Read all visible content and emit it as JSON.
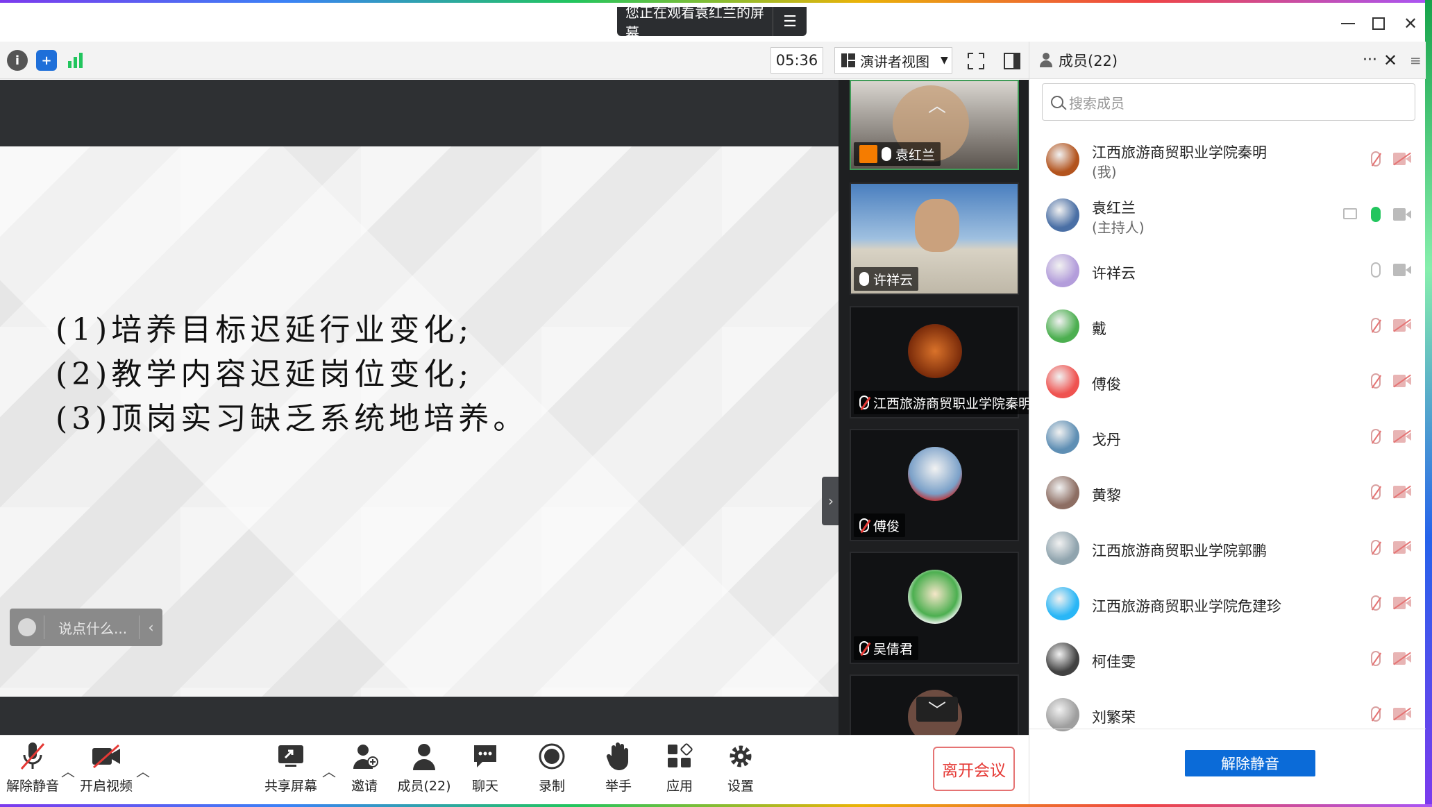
{
  "title_bar": {
    "share_banner": "您正在观看袁红兰的屏幕",
    "menu_glyph": "☰"
  },
  "toolbar": {
    "timer": "05:36",
    "view_mode": "演讲者视图"
  },
  "slide": {
    "lines": [
      "(1)培养目标迟延行业变化;",
      "(2)教学内容迟延岗位变化;",
      "(3)顶岗实习缺乏系统地培养。"
    ]
  },
  "chat_bubble": {
    "placeholder": "说点什么..."
  },
  "video_tiles": [
    {
      "name": "袁红兰",
      "mic": "on",
      "active": true,
      "avatar_color": "#c8a07a"
    },
    {
      "name": "许祥云",
      "mic": "on",
      "active": false,
      "avatar_color": "#8ab4d8"
    },
    {
      "name": "江西旅游商贸职业学院秦明",
      "mic": "off",
      "active": false,
      "avatar_color": "#b3541e"
    },
    {
      "name": "傅俊",
      "mic": "off",
      "active": false,
      "avatar_color": "#7aa0c8"
    },
    {
      "name": "吴倩君",
      "mic": "off",
      "active": false,
      "avatar_color": "#4caf50"
    }
  ],
  "members_panel": {
    "title": "成员(22)",
    "more_glyph": "···",
    "search_placeholder": "搜索成员",
    "members": [
      {
        "name": "江西旅游商贸职业学院秦明",
        "sub": "(我)",
        "mic": "off",
        "cam": "off",
        "avatar_color": "#b3541e"
      },
      {
        "name": "袁红兰",
        "sub": "(主持人)",
        "mic": "green",
        "cam": "on",
        "share": true,
        "avatar_color": "#4a6fa5"
      },
      {
        "name": "许祥云",
        "sub": "",
        "mic": "grey",
        "cam": "on",
        "avatar_color": "#b39ddb"
      },
      {
        "name": "戴",
        "sub": "",
        "mic": "off",
        "cam": "off",
        "avatar_color": "#4caf50"
      },
      {
        "name": "傅俊",
        "sub": "",
        "mic": "off",
        "cam": "off",
        "avatar_color": "#ef5350"
      },
      {
        "name": "戈丹",
        "sub": "",
        "mic": "off",
        "cam": "off",
        "avatar_color": "#5f8fb4"
      },
      {
        "name": "黄黎",
        "sub": "",
        "mic": "off",
        "cam": "off",
        "avatar_color": "#8d6e63"
      },
      {
        "name": "江西旅游商贸职业学院郭鹏",
        "sub": "",
        "mic": "off",
        "cam": "off",
        "avatar_color": "#90a4ae"
      },
      {
        "name": "江西旅游商贸职业学院危建珍",
        "sub": "",
        "mic": "off",
        "cam": "off",
        "avatar_color": "#29b6f6"
      },
      {
        "name": "柯佳雯",
        "sub": "",
        "mic": "off",
        "cam": "off",
        "avatar_color": "#424242"
      },
      {
        "name": "刘繁荣",
        "sub": "",
        "mic": "off",
        "cam": "off",
        "avatar_color": "#9e9e9e"
      }
    ],
    "unmute_all_label": "解除静音"
  },
  "bottom_bar": {
    "unmute": "解除静音",
    "start_video": "开启视频",
    "share_screen": "共享屏幕",
    "invite": "邀请",
    "members": "成员(22)",
    "chat": "聊天",
    "record": "录制",
    "raise_hand": "举手",
    "apps": "应用",
    "settings": "设置",
    "leave": "离开会议"
  },
  "colors": {
    "accent_blue": "#0b6bd8",
    "leave_red": "#e53935",
    "stage_dark": "#2e3033",
    "active_green": "#3f9b57"
  }
}
